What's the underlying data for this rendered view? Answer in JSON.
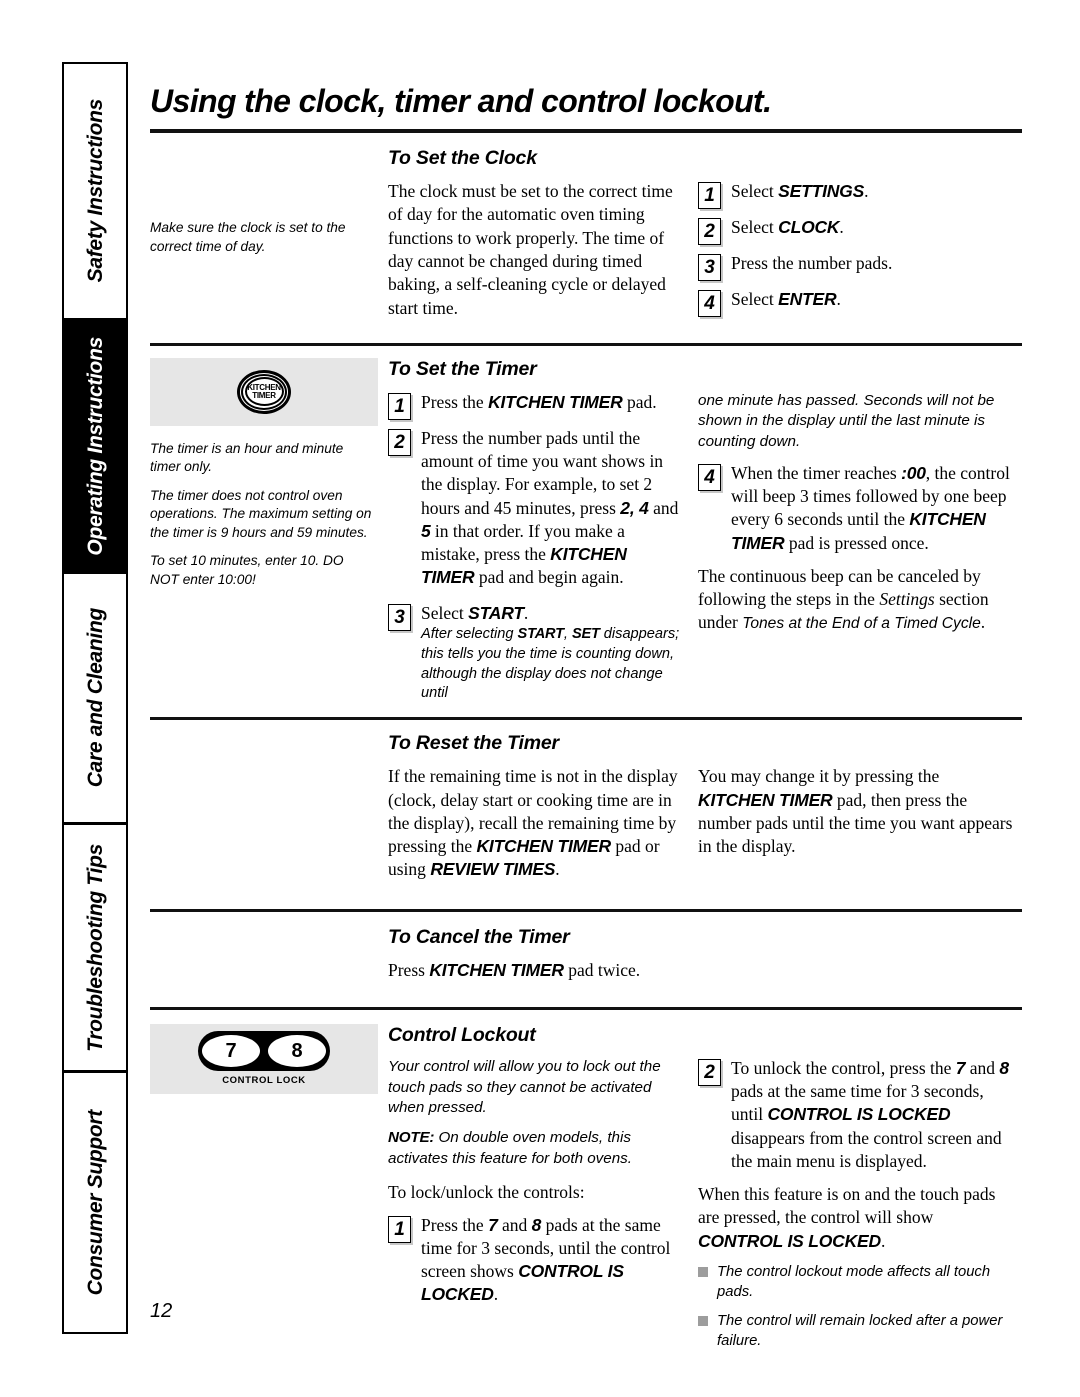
{
  "sidebar": {
    "tabs": [
      {
        "label": "Safety Instructions",
        "active": false
      },
      {
        "label": "Operating Instructions",
        "active": true
      },
      {
        "label": "Care and Cleaning",
        "active": false
      },
      {
        "label": "Troubleshooting Tips",
        "active": false
      },
      {
        "label": "Consumer Support",
        "active": false
      }
    ]
  },
  "page": {
    "title": "Using the clock, timer and control lockout.",
    "number": "12"
  },
  "set_clock": {
    "heading": "To Set the Clock",
    "margin_note": "Make sure the clock is set to the correct time of day.",
    "body": "The clock must be set to the correct time of day for the automatic oven timing functions to work properly. The time of day cannot be changed during timed baking, a self-cleaning cycle or delayed start time.",
    "steps": [
      {
        "num": "1",
        "text_pre": "Select ",
        "bold": "SETTINGS",
        "text_post": "."
      },
      {
        "num": "2",
        "text_pre": "Select ",
        "bold": "CLOCK",
        "text_post": "."
      },
      {
        "num": "3",
        "text_pre": "Press the number pads.",
        "bold": "",
        "text_post": ""
      },
      {
        "num": "4",
        "text_pre": "Select ",
        "bold": "ENTER",
        "text_post": "."
      }
    ]
  },
  "set_timer": {
    "heading": "To Set the Timer",
    "figure": {
      "name": "kitchen-timer-pad",
      "line1": "KITCHEN",
      "line2": "TIMER"
    },
    "margin_notes": [
      "The timer is an hour and minute timer only.",
      "The timer does not control oven operations. The maximum setting on the timer is 9 hours and 59 minutes.",
      "To set 10 minutes, enter 10. DO NOT enter 10:00!"
    ],
    "step1": {
      "num": "1",
      "a": "Press the ",
      "b": "KITCHEN TIMER",
      "c": " pad."
    },
    "step2": {
      "num": "2",
      "a": "Press the number pads until the amount of time you want shows in the display. For example, to set 2 hours and 45 minutes, press ",
      "b": "2, 4",
      "c": " and ",
      "d": "5",
      "e": " in that order. If you make a mistake, press the ",
      "f": "KITCHEN TIMER",
      "g": " pad and begin again."
    },
    "step3": {
      "num": "3",
      "a": "Select ",
      "b": "START",
      "c": ".",
      "sub_a": "After selecting ",
      "sub_b": "START",
      "sub_c": ", ",
      "sub_d": "SET",
      "sub_e": " disappears; this tells you the time is counting down, although the display does not change until"
    },
    "right_continued": "one minute has passed. Seconds will not be shown in the display until the last minute is counting down.",
    "step4": {
      "num": "4",
      "a": "When the timer reaches ",
      "b": ":00",
      "c": ", the control will beep 3 times followed by one beep every 6 seconds until the ",
      "d": "KITCHEN TIMER",
      "e": " pad is pressed once."
    },
    "closing": {
      "a": "The continuous beep can be canceled by following the steps in the ",
      "b": "Settings",
      "c": " section under ",
      "d": "Tones at the End of a Timed Cycle",
      "e": "."
    }
  },
  "reset_timer": {
    "heading": "To Reset the Timer",
    "left": {
      "a": "If the remaining time is not in the display (clock, delay start or cooking time are in the display), recall the remaining time by pressing the ",
      "b": "KITCHEN TIMER",
      "c": " pad or using ",
      "d": "REVIEW TIMES",
      "e": "."
    },
    "right": {
      "a": "You may change it by pressing the ",
      "b": "KITCHEN TIMER",
      "c": " pad, then press the number pads until the time you want appears in the display."
    }
  },
  "cancel_timer": {
    "heading": "To Cancel the Timer",
    "body": {
      "a": "Press ",
      "b": "KITCHEN TIMER",
      "c": " pad twice."
    }
  },
  "control_lockout": {
    "heading": "Control Lockout",
    "figure": {
      "name": "control-lock-pad",
      "key_left": "7",
      "key_right": "8",
      "caption": "CONTROL LOCK"
    },
    "intro": "Your control will allow you to lock out the touch pads so they cannot be activated when pressed.",
    "note": {
      "label": "NOTE:",
      "text": " On double oven models, this activates this feature for both ovens."
    },
    "lead_in": "To lock/unlock the controls:",
    "step1": {
      "num": "1",
      "a": "Press the ",
      "b": "7",
      "c": " and ",
      "d": "8",
      "e": " pads at the same time for 3 seconds, until the control screen shows ",
      "f": "CONTROL IS LOCKED",
      "g": "."
    },
    "step2": {
      "num": "2",
      "a": "To unlock the control, press the ",
      "b": "7",
      "c": " and ",
      "d": "8",
      "e": " pads at the same time for 3 seconds, until ",
      "f": "CONTROL IS LOCKED",
      "g": " disappears from the control screen and the main menu is displayed."
    },
    "closing": {
      "a": "When this feature is on and the touch pads are pressed, the control will show ",
      "b": "CONTROL IS LOCKED",
      "c": "."
    },
    "bullets": [
      "The control lockout mode affects all touch pads.",
      "The control will remain locked after a power failure."
    ]
  },
  "colors": {
    "figure_background": "#e6e6e6",
    "active_tab_background": "#000000",
    "bullet_square": "#9d9d9d"
  }
}
